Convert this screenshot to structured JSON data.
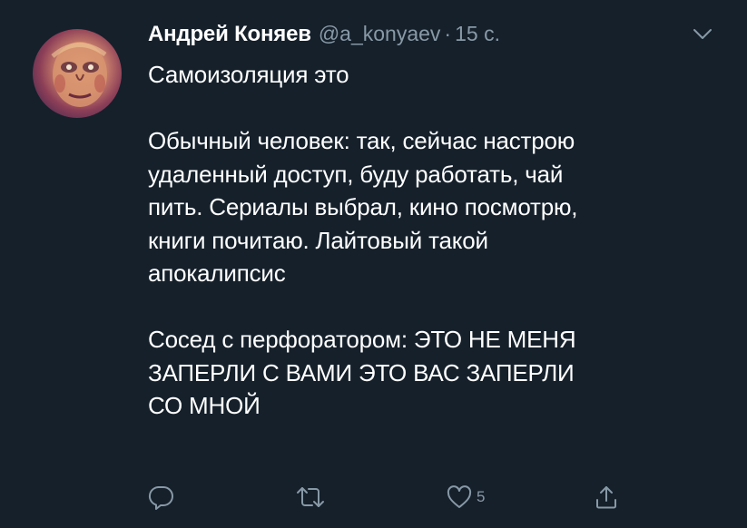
{
  "tweet": {
    "author_name": "Андрей Коняев",
    "author_handle": "@a_konyaev",
    "separator": "·",
    "timestamp": "15 с.",
    "lines": [
      "Самоизоляция это",
      "",
      "Обычный человек: так, сейчас настрою",
      "удаленный доступ, буду работать, чай",
      "пить. Сериалы выбрал, кино посмотрю,",
      "книги почитаю. Лайтовый такой",
      "апокалипсис",
      "",
      "Сосед с перфоратором: ЭТО НЕ МЕНЯ",
      "ЗАПЕРЛИ С ВАМИ ЭТО ВАС ЗАПЕРЛИ",
      "СО МНОЙ"
    ],
    "like_count": "5"
  },
  "icons": {
    "reply": "reply-icon",
    "retweet": "retweet-icon",
    "like": "heart-icon",
    "share": "share-icon",
    "menu": "chevron-down-icon"
  },
  "colors": {
    "background": "#15202b",
    "text": "#ffffff",
    "secondary": "#8899a6"
  }
}
